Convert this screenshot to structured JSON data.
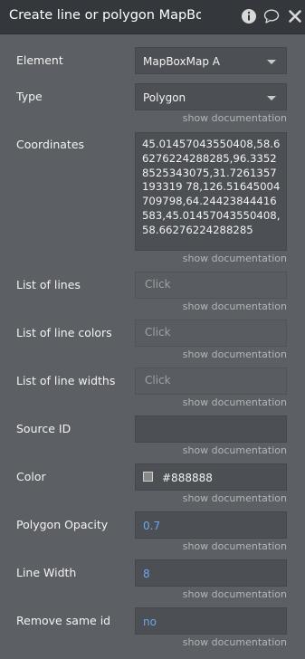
{
  "header": {
    "title": "Create line or polygon MapBoxM",
    "icons": [
      "info-icon",
      "comment-icon",
      "close-icon"
    ]
  },
  "doc_link": "show documentation",
  "element": {
    "label": "Element",
    "value": "MapBoxMap A"
  },
  "type": {
    "label": "Type",
    "value": "Polygon"
  },
  "coordinates": {
    "label": "Coordinates",
    "value": "45.01457043550408,58.66276224288285,96.33528525343075,31.7261357193319 78,126.51645004709798,64.24423844416583,45.01457043550408,58.66276224288285"
  },
  "list_of_lines": {
    "label": "List of lines",
    "button": "Click"
  },
  "list_of_line_colors": {
    "label": "List of line colors",
    "button": "Click"
  },
  "list_of_line_widths": {
    "label": "List of line widths",
    "button": "Click"
  },
  "source_id": {
    "label": "Source ID",
    "value": ""
  },
  "color": {
    "label": "Color",
    "value": "#888888",
    "swatch": "#888888"
  },
  "polygon_opacity": {
    "label": "Polygon Opacity",
    "value": "0.7"
  },
  "line_width": {
    "label": "Line Width",
    "value": "8"
  },
  "remove_same_id": {
    "label": "Remove same id",
    "value": "no"
  }
}
